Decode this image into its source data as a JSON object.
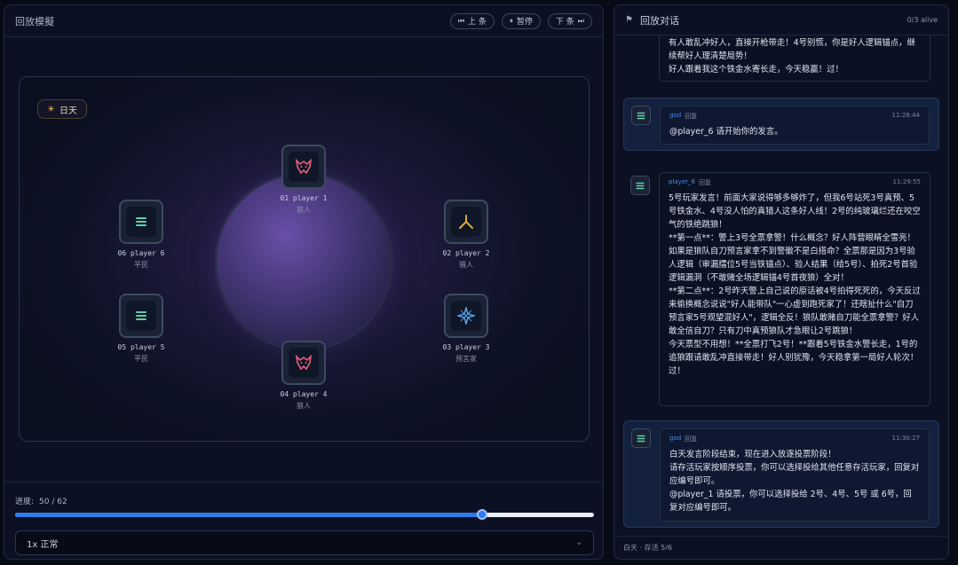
{
  "replay": {
    "title": "回放模擬",
    "prev_label": "上 条",
    "pause_label": "暂停",
    "next_label": "下 条",
    "phase": "日天",
    "progress_label": "进度:",
    "progress_text": "50 / 62",
    "progress_current": 50,
    "progress_total": 62,
    "speed_option": "1x 正常",
    "seats": [
      {
        "name": "01 player 1",
        "role": "狼人",
        "icon": "wolf-icon",
        "color": "#e8627a"
      },
      {
        "name": "02 player 2",
        "role": "猎人",
        "icon": "hunter-icon",
        "color": "#e0a93a"
      },
      {
        "name": "03 player 3",
        "role": "预言家",
        "icon": "seer-icon",
        "color": "#5aa6ee"
      },
      {
        "name": "04 player 4",
        "role": "狼人",
        "icon": "wolf-icon",
        "color": "#e8627a"
      },
      {
        "name": "05 player 5",
        "role": "平民",
        "icon": "villager-icon",
        "color": "#5fd0a8"
      },
      {
        "name": "06 player 6",
        "role": "平民",
        "icon": "villager-icon",
        "color": "#5fd0a8"
      }
    ]
  },
  "chat": {
    "title": "回放对话",
    "count": "0/3 alive",
    "messages": [
      {
        "sender": "",
        "tag": "",
        "time": "",
        "text": "有人敢乱冲好人，直接开枪带走！4号别慌，你是好人逻辑锚点，继续帮好人理清楚局势！\n好人跟着我这个铁金水寄长走，今天稳赢！过！"
      },
      {
        "sender": "god",
        "tag": "回复",
        "time": "11:28:44",
        "text": "@player_6 请开始你的发言。"
      },
      {
        "sender": "player_6",
        "tag": "回复",
        "time": "11:29:55",
        "text": "5号玩家发言！前面大家说得够多够炸了，但我6号站死3号真预、5号铁金水、4号没人怕的真猎人这条好人线！2号的纯玻璃烂还在咬空气的铁绝跳狼！\n**第一点**：警上3号全票拿警！什么概念？好人阵营眼睛全雪亮！如果是狼队自刀预言家拿不到警徽不是白搭命？全票那是因为3号验人逻辑（审漏擂位5号当铁锚点）、验人结果（给5号）、拍死2号首验逻辑漏洞（不敢赌全场逻辑锚4号首夜狼）全对！\n**第二点**：2号昨天警上自己说的原话被4号拍得死死的，今天反过来偷换概念说说\"好人能带队\"一心虚到跑死家了！还瞎扯什么\"自刀预言家5号观望混好人\"，逻辑全反！狼队敢赌自刀能全票拿警？好人敢全信自刀？只有刀中真预狼队才急眼让2号跳狼！\n今天票型不用想！**全票打飞2号！**跟着5号铁金水警长走，1号的追狼跟请敢乱冲直接带走！好人别犹豫，今天稳拿第一局好人轮次！过！"
      },
      {
        "sender": "god",
        "tag": "回复",
        "time": "11:30:27",
        "text": "白天发言阶段结束，现在进入放逐投票阶段！\n请存活玩家按顺序投票，你可以选择投给其他任意存活玩家，回复对应编号即可。\n@player_1 请投票，你可以选择投给 2号、4号、5号 或 6号，回复对应编号即可。"
      }
    ],
    "footer": "白天 · 存活 5/6"
  }
}
